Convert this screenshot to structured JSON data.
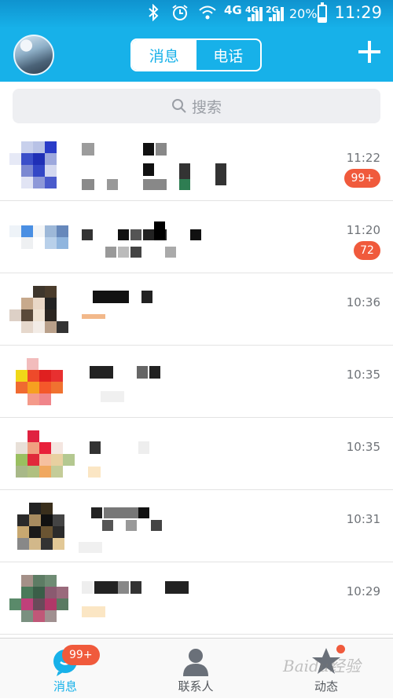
{
  "status_bar": {
    "network_4g": "4G",
    "network_4g_small": "4G",
    "network_2g_small": "2G",
    "battery_percent": "20%",
    "clock": "11:29",
    "icons": [
      "bluetooth-icon",
      "alarm-icon",
      "wifi-icon",
      "signal-icon",
      "battery-icon"
    ]
  },
  "header": {
    "tabs": [
      {
        "label": "消息",
        "selected": true
      },
      {
        "label": "电话",
        "selected": false
      }
    ],
    "add_icon": "plus-icon",
    "accent_color": "#17b1e9"
  },
  "search": {
    "placeholder": "搜索",
    "icon": "search-icon"
  },
  "conversations": [
    {
      "time": "11:22",
      "badge": "99+"
    },
    {
      "time": "11:20",
      "badge": "72"
    },
    {
      "time": "10:36",
      "badge": ""
    },
    {
      "time": "10:35",
      "badge": ""
    },
    {
      "time": "10:35",
      "badge": ""
    },
    {
      "time": "10:31",
      "badge": ""
    },
    {
      "time": "10:29",
      "badge": ""
    }
  ],
  "tabbar": {
    "tabs": [
      {
        "label": "消息",
        "badge": "99+",
        "active": true,
        "icon": "message-icon"
      },
      {
        "label": "联系人",
        "badge": "",
        "active": false,
        "icon": "contacts-icon"
      },
      {
        "label": "动态",
        "badge": "",
        "active": false,
        "icon": "star-icon",
        "dot": true
      }
    ],
    "badge_color": "#f05a3c"
  },
  "watermark": "Baidu经验"
}
